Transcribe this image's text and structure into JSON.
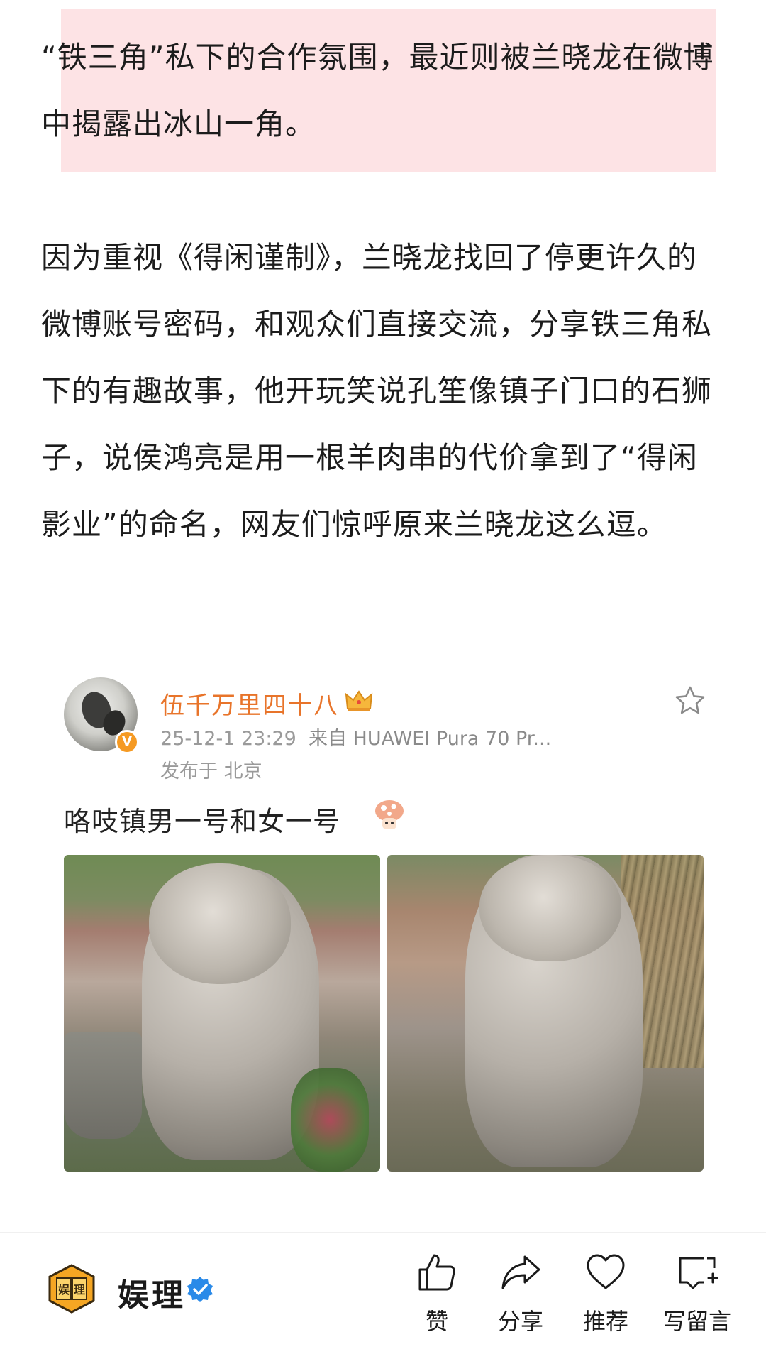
{
  "article": {
    "para1": "“铁三角”私下的合作氛围，最近则被兰晓龙在微博中揭露出冰山一角。",
    "para2": "因为重视《得闲谨制》，兰晓龙找回了停更许久的微博账号密码，和观众们直接交流，分享铁三角私下的有趣故事，他开玩笑说孔笙像镇子门口的石狮子，说侯鸿亮是用一根羊肉串的代价拿到了“得闲影业”的命名，网友们惊呼原来兰晓龙这么逗。",
    "highlight_color": "#fde3e5"
  },
  "weibo_post": {
    "username": "伍千万里四十八",
    "username_color": "#e8742a",
    "timestamp": "25-12-1 23:29",
    "source": "来自 HUAWEI Pura 70 Pr...",
    "location": "发布于 北京",
    "text": "咯吱镇男一号和女一号",
    "icons": [
      "crown-icon",
      "star-icon",
      "mushroom-emoji-icon",
      "verified-v-icon"
    ],
    "verified_badge": "V"
  },
  "bottom_bar": {
    "brand_name": "娱理",
    "logo_text": "娱理",
    "actions": {
      "like": "赞",
      "share": "分享",
      "recommend": "推荐",
      "comment": "写留言"
    },
    "verified_color": "#2a8ae8"
  }
}
